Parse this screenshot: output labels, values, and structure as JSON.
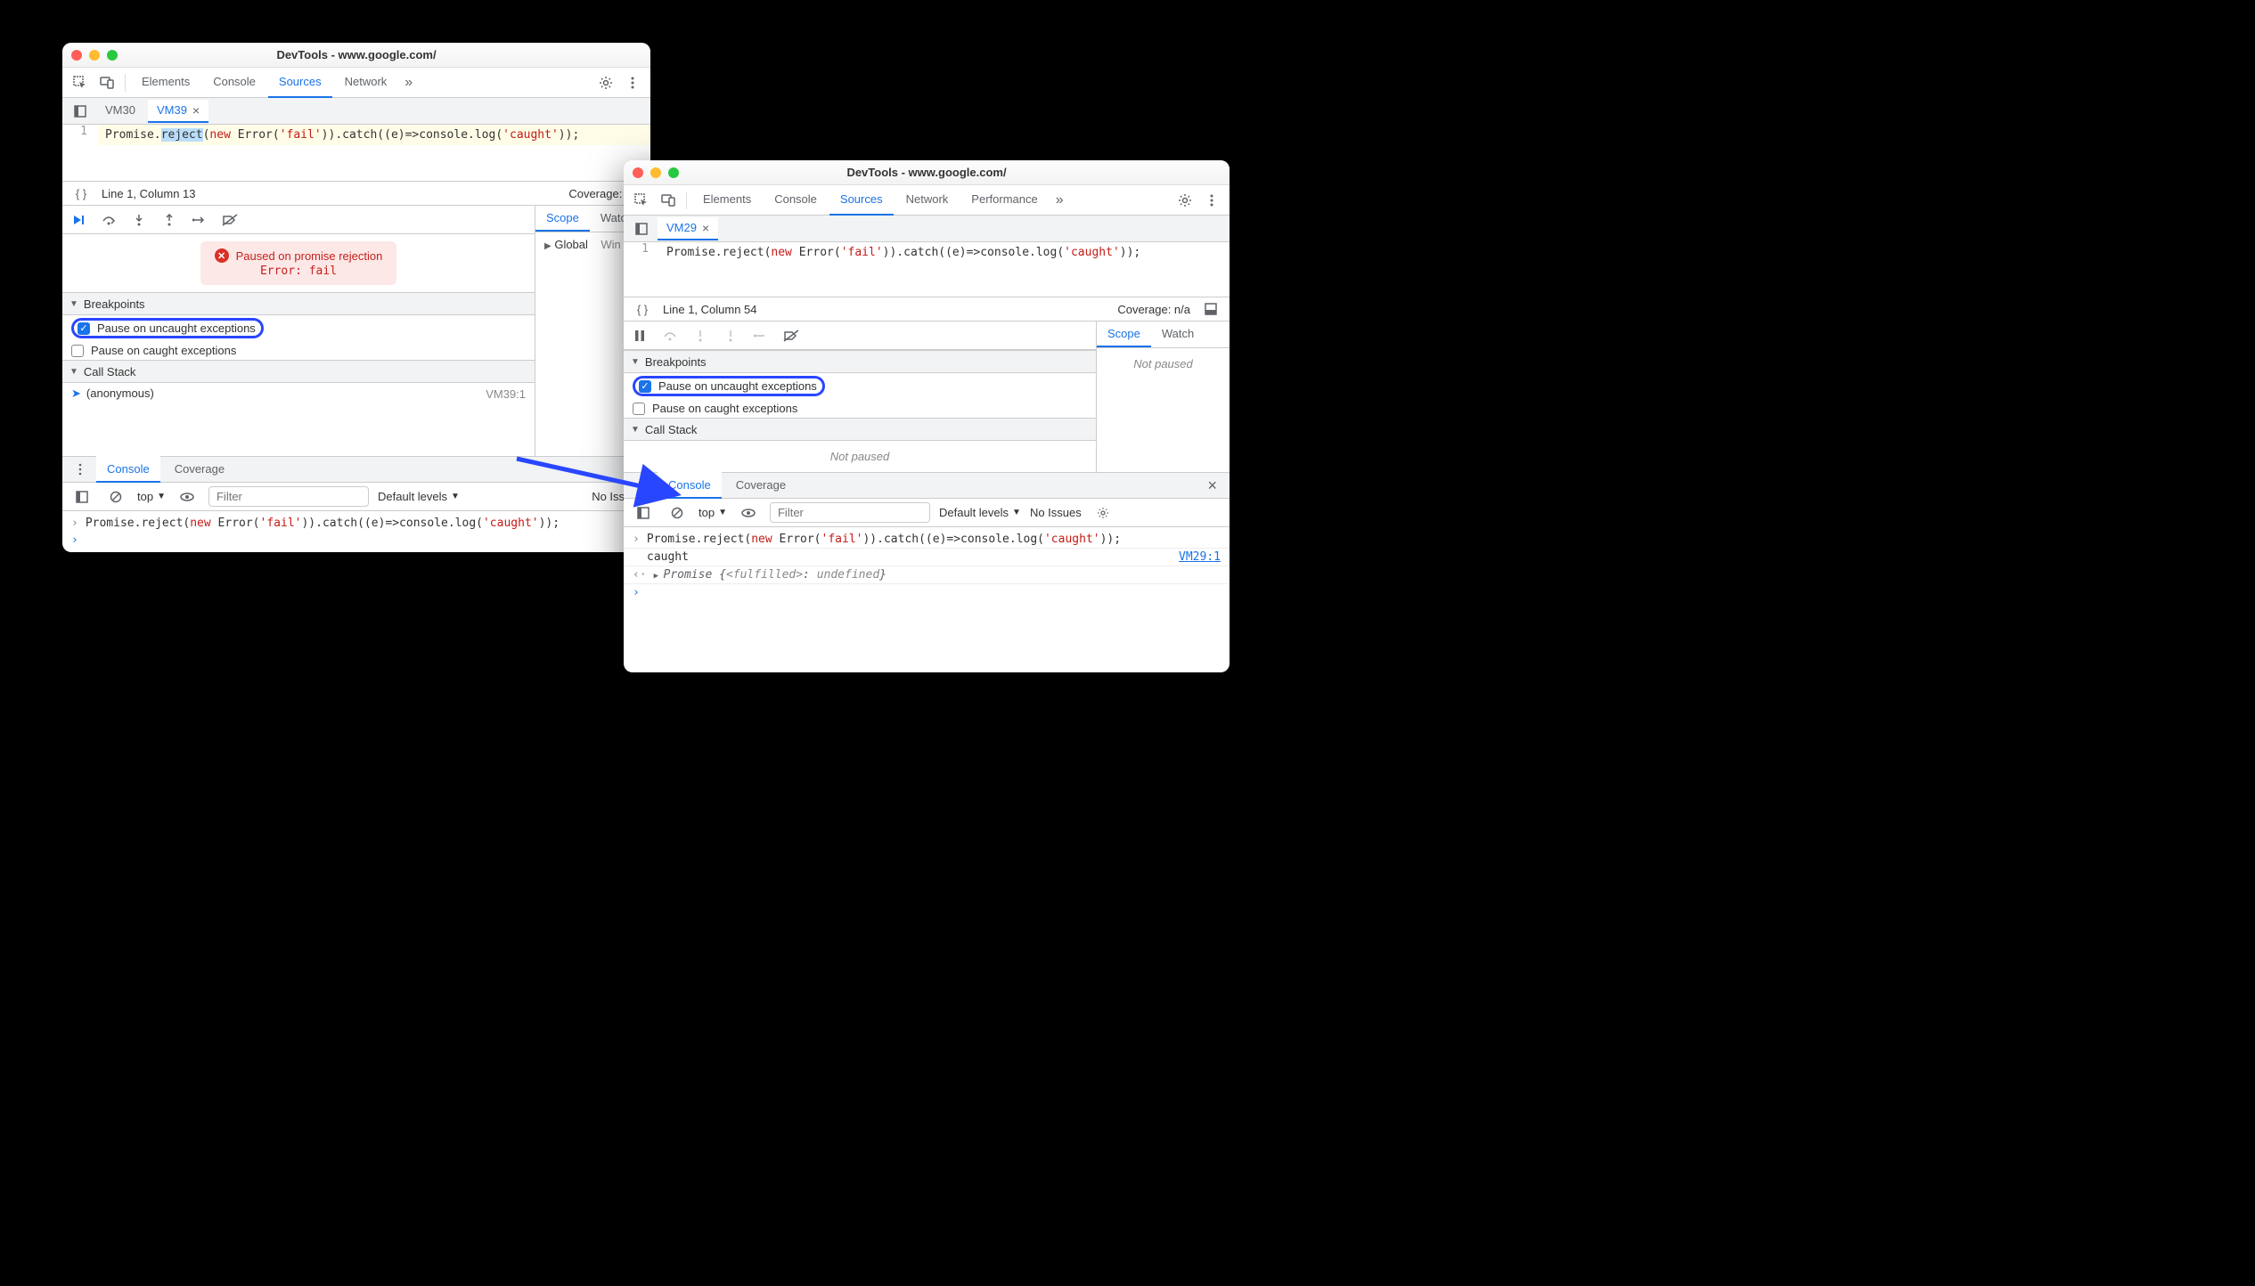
{
  "left": {
    "title": "DevTools - www.google.com/",
    "main_tabs": [
      "Elements",
      "Console",
      "Sources",
      "Network"
    ],
    "active_main_tab": "Sources",
    "file_tabs": [
      "VM30",
      "VM39"
    ],
    "active_file_tab": "VM39",
    "code": {
      "line_number": "1",
      "pre": "Promise.",
      "sel": "reject",
      "mid1": "(",
      "kw_new": "new",
      "mid2": " Error(",
      "str1": "'fail'",
      "mid3": ")).catch((e)=>console.log(",
      "str2": "'caught'",
      "mid4": "));"
    },
    "status": {
      "pos": "Line 1, Column 13",
      "coverage": "Coverage: n/a"
    },
    "pause_banner": {
      "title": "Paused on promise rejection",
      "detail": "Error: fail"
    },
    "sections": {
      "breakpoints": "Breakpoints",
      "bp_uncaught": "Pause on uncaught exceptions",
      "bp_caught": "Pause on caught exceptions",
      "callstack": "Call Stack",
      "cs_frame": "(anonymous)",
      "cs_src": "VM39:1"
    },
    "side_tabs": [
      "Scope",
      "Watch"
    ],
    "active_side_tab": "Scope",
    "scope": {
      "global": "Global",
      "win": "Win"
    },
    "drawer_tabs": [
      "Console",
      "Coverage"
    ],
    "active_drawer_tab": "Console",
    "console_toolbar": {
      "context": "top",
      "filter_placeholder": "Filter",
      "levels": "Default levels",
      "issues": "No Issues"
    },
    "console": {
      "input_pre": "Promise.reject(",
      "kw_new": "new",
      "input_mid1": " Error(",
      "str1": "'fail'",
      "input_mid2": ")).catch((e)=>console.log(",
      "str2": "'caught'",
      "input_mid3": "));"
    }
  },
  "right": {
    "title": "DevTools - www.google.com/",
    "main_tabs": [
      "Elements",
      "Console",
      "Sources",
      "Network",
      "Performance"
    ],
    "active_main_tab": "Sources",
    "file_tabs": [
      "VM29"
    ],
    "active_file_tab": "VM29",
    "code": {
      "line_number": "1",
      "pre": "Promise.reject(",
      "kw_new": "new",
      "mid1": " Error(",
      "str1": "'fail'",
      "mid2": ")).catch((e)=>console.log(",
      "str2": "'caught'",
      "mid3": "));"
    },
    "status": {
      "pos": "Line 1, Column 54",
      "coverage": "Coverage: n/a"
    },
    "sections": {
      "breakpoints": "Breakpoints",
      "bp_uncaught": "Pause on uncaught exceptions",
      "bp_caught": "Pause on caught exceptions",
      "callstack": "Call Stack",
      "not_paused": "Not paused"
    },
    "side_tabs": [
      "Scope",
      "Watch"
    ],
    "active_side_tab": "Scope",
    "scope_not_paused": "Not paused",
    "drawer_tabs": [
      "Console",
      "Coverage"
    ],
    "active_drawer_tab": "Console",
    "console_toolbar": {
      "context": "top",
      "filter_placeholder": "Filter",
      "levels": "Default levels",
      "issues": "No Issues"
    },
    "console": {
      "input_pre": "Promise.reject(",
      "kw_new": "new",
      "input_mid1": " Error(",
      "str1": "'fail'",
      "input_mid2": ")).catch((e)=>console.log(",
      "str2": "'caught'",
      "input_mid3": "));",
      "log_output": "caught",
      "log_src": "VM29:1",
      "result_pre": "Promise {",
      "result_state": "<fulfilled>",
      "result_mid": ": ",
      "result_val": "undefined",
      "result_post": "}"
    }
  }
}
